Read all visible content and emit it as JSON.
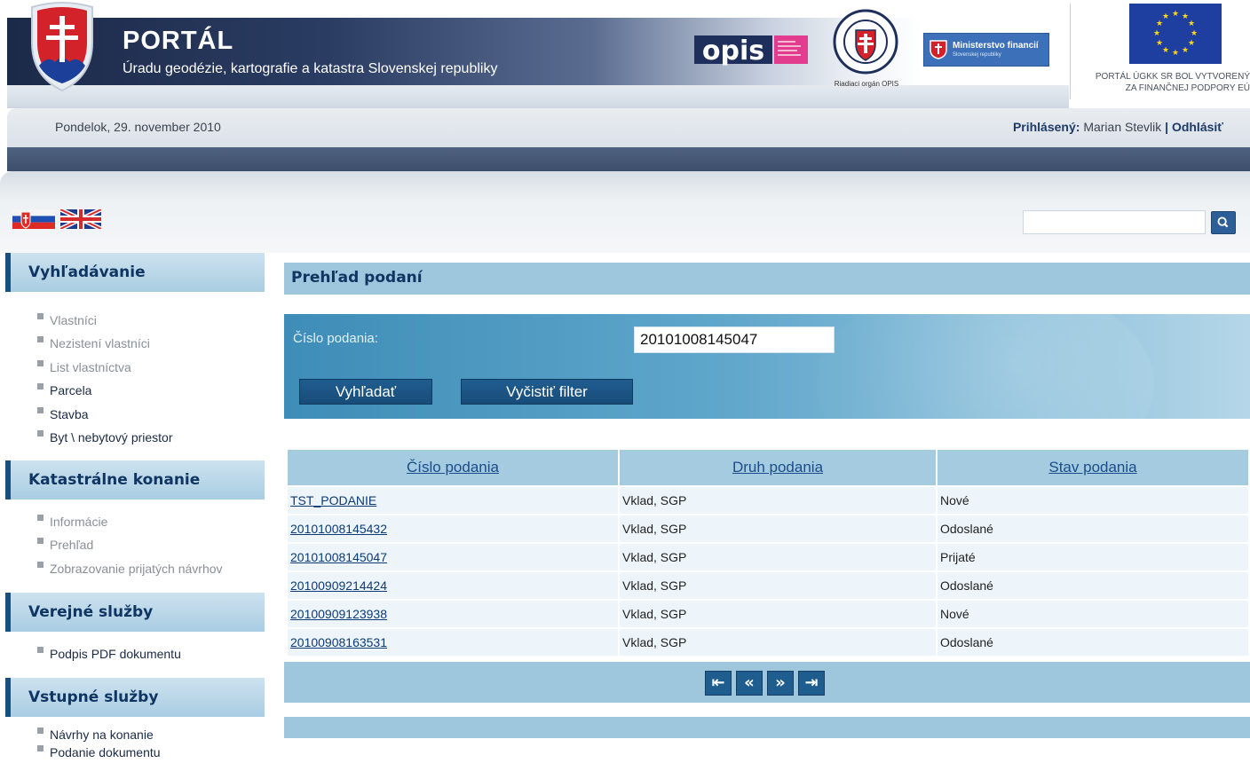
{
  "header": {
    "title": "PORTÁL",
    "subtitle": "Úradu geodézie, kartografie a katastra Slovenskej republiky",
    "opis_label": "opis",
    "riadiaci_label": "Riadiaci orgán OPIS",
    "mf_label": "Ministerstvo financií",
    "mf_sub": "Slovenskej republiky",
    "eu_text_line1": "PORTÁL ÚGKK SR BOL VYTVORENÝ",
    "eu_text_line2": "ZA FINANČNEJ PODPORY EÚ",
    "colors": {
      "band_dark": "#1c2a49",
      "accent": "#0f3563"
    }
  },
  "infobar": {
    "date": "Pondelok, 29. november 2010",
    "logged_label": "Prihlásený:",
    "user_name": "Marian Stevlik",
    "separator": "|",
    "logout": "Odhlásiť"
  },
  "languages": [
    {
      "code": "sk",
      "icon": "slovak-flag-icon"
    },
    {
      "code": "en",
      "icon": "uk-flag-icon"
    }
  ],
  "search": {
    "placeholder": "",
    "icon": "search-icon"
  },
  "sidebar": {
    "sections": [
      {
        "title": "Vyhľadávanie",
        "items": [
          "Vlastníci",
          "Nezistení vlastníci",
          "List vlastníctva",
          "Parcela",
          "Stavba",
          "Byt \\ nebytový priestor"
        ]
      },
      {
        "title": "Katastrálne konanie",
        "items": [
          "Informácie",
          "Prehľad",
          "Zobrazovanie prijatých návrhov"
        ]
      },
      {
        "title": "Verejné služby",
        "items": [
          "Podpis PDF dokumentu"
        ]
      },
      {
        "title": "Vstupné služby",
        "items": [
          "Návrhy na konanie",
          "Podanie dokumentu"
        ]
      }
    ]
  },
  "main": {
    "title": "Prehľad podaní",
    "filter": {
      "label": "Číslo podania:",
      "value": "20101008145047",
      "search_button": "Vyhľadať",
      "clear_button": "Vyčistiť filter"
    },
    "table": {
      "columns": [
        "Číslo podania",
        "Druh podania",
        "Stav podania"
      ],
      "rows": [
        [
          "TST_PODANIE",
          "Vklad, SGP",
          "Nové"
        ],
        [
          "20101008145432",
          "Vklad, SGP",
          "Odoslané"
        ],
        [
          "20101008145047",
          "Vklad, SGP",
          "Prijaté"
        ],
        [
          "20100909214424",
          "Vklad, SGP",
          "Odoslané"
        ],
        [
          "20100909123938",
          "Vklad, SGP",
          "Nové"
        ],
        [
          "20100908163531",
          "Vklad, SGP",
          "Odoslané"
        ]
      ]
    },
    "pager": {
      "first": "⇤",
      "prev": "«",
      "next": "»",
      "last": "⇥"
    }
  }
}
